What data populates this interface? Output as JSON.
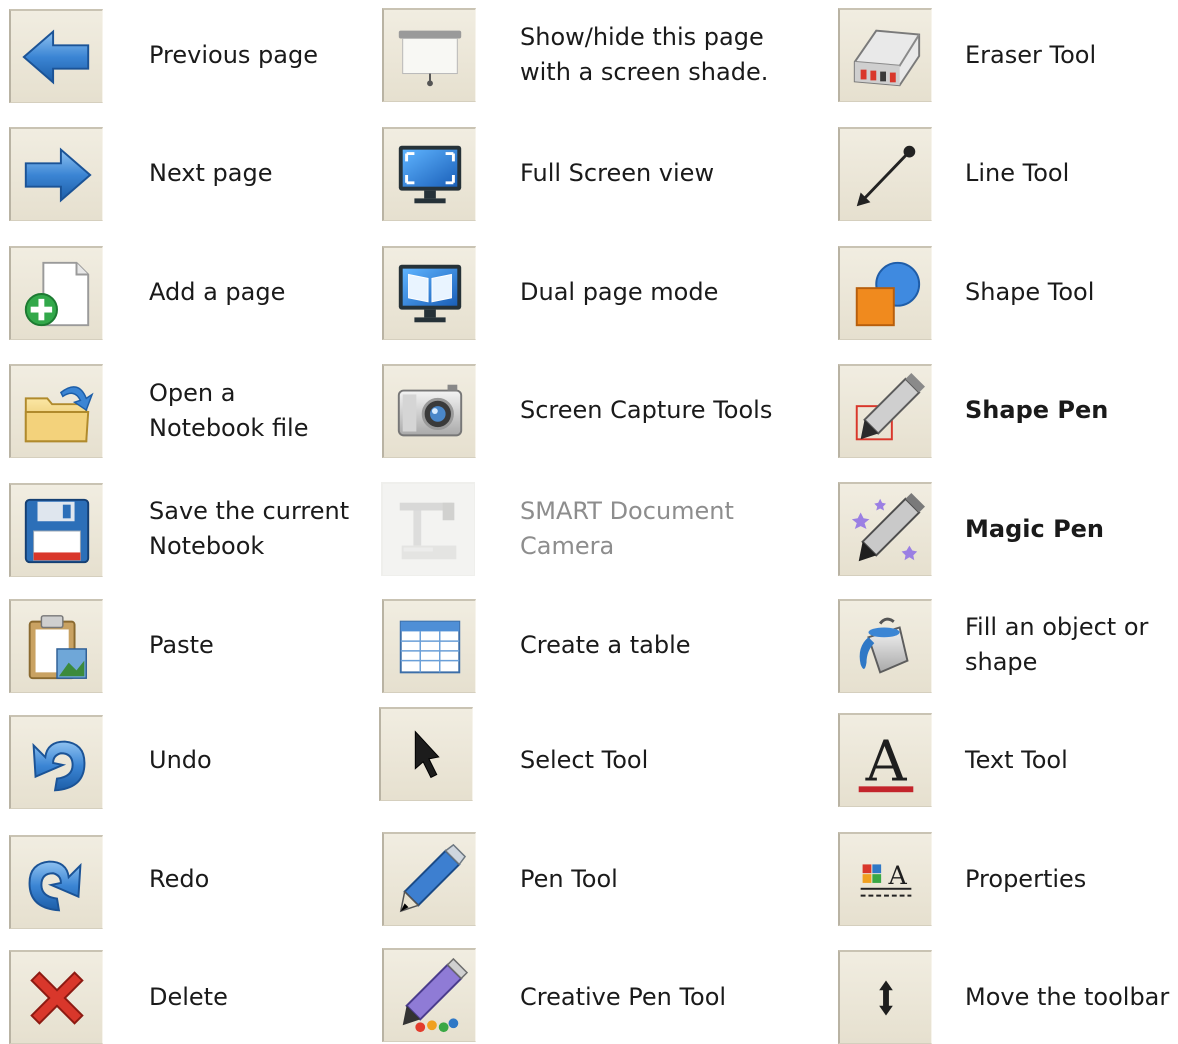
{
  "column_1": [
    {
      "icon": "previous-page-arrow-icon",
      "label": "Previous page"
    },
    {
      "icon": "next-page-arrow-icon",
      "label": "Next page"
    },
    {
      "icon": "add-page-icon",
      "label": "Add a page"
    },
    {
      "icon": "open-folder-icon",
      "label_line_1": "Open a",
      "label_line_2": "Notebook file"
    },
    {
      "icon": "floppy-disk-save-icon",
      "label_line_1": "Save the current",
      "label_line_2": "Notebook"
    },
    {
      "icon": "clipboard-paste-icon",
      "label": "Paste"
    },
    {
      "icon": "undo-arrow-icon",
      "label": "Undo"
    },
    {
      "icon": "redo-arrow-icon",
      "label": "Redo"
    },
    {
      "icon": "red-x-delete-icon",
      "label": "Delete"
    }
  ],
  "column_2": [
    {
      "icon": "screen-shade-icon",
      "label_line_1": "Show/hide this page",
      "label_line_2": "with a screen shade."
    },
    {
      "icon": "full-screen-monitor-icon",
      "label": "Full Screen view"
    },
    {
      "icon": "dual-page-monitor-icon",
      "label": "Dual page mode"
    },
    {
      "icon": "camera-icon",
      "label": "Screen Capture Tools"
    },
    {
      "icon": "document-camera-icon",
      "label_line_1": "SMART Document",
      "label_line_2": "Camera",
      "disabled": true
    },
    {
      "icon": "table-grid-icon",
      "label": "Create a table"
    },
    {
      "icon": "select-arrow-cursor-icon",
      "label": "Select Tool"
    },
    {
      "icon": "pen-icon",
      "label": "Pen Tool"
    },
    {
      "icon": "creative-pen-icon",
      "label": "Creative Pen Tool"
    }
  ],
  "column_3": [
    {
      "icon": "eraser-icon",
      "label": "Eraser Tool"
    },
    {
      "icon": "line-tool-icon",
      "label": "Line Tool"
    },
    {
      "icon": "shapes-icon",
      "label": "Shape Tool"
    },
    {
      "icon": "shape-pen-icon",
      "label": "Shape Pen",
      "bold": true
    },
    {
      "icon": "magic-pen-icon",
      "label": "Magic Pen",
      "bold": true
    },
    {
      "icon": "paint-bucket-fill-icon",
      "label_line_1": "Fill an object or",
      "label_line_2": "shape"
    },
    {
      "icon": "text-tool-letter-a-icon",
      "label": "Text Tool"
    },
    {
      "icon": "properties-icon",
      "label": "Properties"
    },
    {
      "icon": "move-toolbar-arrows-icon",
      "label": "Move the toolbar"
    }
  ],
  "colors": {
    "tile_background": "#e9e4d5",
    "icon_blue": "#2f78c6",
    "delete_red": "#d9372b",
    "disabled_text": "#8d8d8d"
  }
}
